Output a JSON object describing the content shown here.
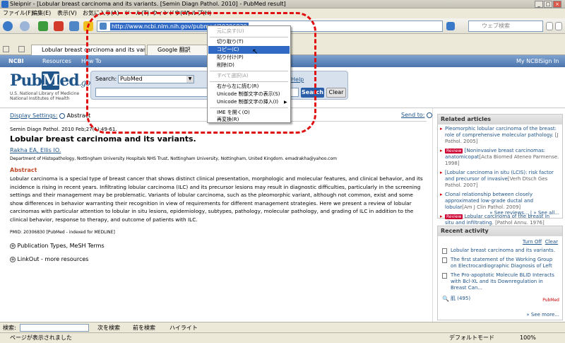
{
  "window": {
    "title": "Sleipnir - [Lobular breast carcinoma and its variants. [Semin Diagn Pathol. 2010] - PubMed result]",
    "min": "_",
    "max": "□",
    "close": "×"
  },
  "menubar": [
    "ファイル(F)",
    "編集(E)",
    "表示(V)",
    "お気に入り(A)",
    "ツール(T)",
    "ウィンドウ(W)",
    "ヘルプ(H)"
  ],
  "address": {
    "url": "http://www.ncbi.nlm.nih.gov/pubmed/20306830"
  },
  "websearch": {
    "placeholder": "ウェブ検索"
  },
  "tabs": [
    {
      "label": "Lobular breast carcinoma and its variants. [..."
    },
    {
      "label": "Google 翻訳"
    }
  ],
  "ncbi": {
    "logo": "NCBI",
    "resources": "Resources",
    "howto": "How To",
    "myncbi": "My NCBI",
    "signin": "Sign In"
  },
  "pubmed": {
    "logo_pub": "Pub",
    "logo_m": "M",
    "logo_ed": "ed",
    "logo_gov": ".gov",
    "nlm1": "U.S. National Library of Medicine",
    "nlm2": "National Institutes of Health",
    "search_label": "Search:",
    "db": "PubMed",
    "search_btn": "Search",
    "clear_btn": "Clear",
    "help": "Help"
  },
  "article": {
    "display_settings": "Display Settings:",
    "format": "Abstract",
    "send_to": "Send to:",
    "citation": "Semin Diagn Pathol. 2010 Feb;27(1):49-61.",
    "title": "Lobular breast carcinoma and its variants.",
    "authors": "Rakha EA, Ellis IO.",
    "affiliation": "Department of Histopathology, Nottingham University Hospitals NHS Trust, Nottingham University, Nottingham, United Kingdom. emadrakha@yahoo.com",
    "abstract_heading": "Abstract",
    "abstract": "Lobular carcinoma is a special type of breast cancer that shows distinct clinical presentation, morphologic and molecular features, and clinical behavior, and its incidence is rising in recent years. Infiltrating lobular carcinoma (ILC) and its precursor lesions may result in diagnostic difficulties, particularly in the screening settings and their management may be problematic. Variants of lobular carcinoma, such as the pleomorphic variant, although not common, exist and some show differences in behavior warranting their recognition in view of requirements for different management strategies. Here we present a review of lobular carcinomas with particular attention to lobular in situ lesions, epidemiology, subtypes, pathology, molecular pathology, and grading of ILC in addition to the clinical behavior, response to therapy, and outcome of patients with ILC.",
    "pmid": "PMID: 20306830 [PubMed - indexed for MEDLINE]",
    "pubtypes": "Publication Types, MeSH Terms",
    "linkout": "LinkOut - more resources"
  },
  "related": {
    "heading": "Related articles",
    "items": [
      {
        "text": "Pleomorphic lobular carcinoma of the breast: role of comprehensive molecular pathology.",
        "review": "",
        "src": "[J Pathol. 2005]"
      },
      {
        "text": "[Noninvasive breast carcinomas: anatomicopat",
        "review": "Review",
        "src": "[Acta Biomed Ateneo Parmense. 1998]"
      },
      {
        "text": "[Lobular carcinoma in situ (LCIS): risk factor and precursor of invasive",
        "review": "",
        "src": "[Verh Dtsch Ges Pathol. 2007]"
      },
      {
        "text": "Clonal relationship between closely approximated low-grade ductal and lobular",
        "review": "",
        "src": "[Am J Clin Pathol. 2009]"
      },
      {
        "text": "Lobular carcinoma of the breast in situ and infiltrating.",
        "review": "Review",
        "src": "[Pathol Annu. 1976]"
      }
    ],
    "see_reviews": "» See reviews...",
    "see_all": "» See all..."
  },
  "recent": {
    "heading": "Recent activity",
    "turn_off": "Turn Off",
    "clear": "Clear",
    "items": [
      "Lobular breast carcinoma and its variants.",
      "The first statement of the Working Group on Electrocardiographic Diagnosis of Left",
      "The Pro-apoptotic Molecule BLID Interacts with Bcl-XL and Its Downregulation in Breast Can..."
    ],
    "search_term": "肌 (495)",
    "pubmed_tag": "PubMed",
    "see_more": "» See more..."
  },
  "findbar": {
    "label": "検索:",
    "next": "次を検索",
    "prev": "前を検索",
    "highlight": "ハイライト"
  },
  "status": {
    "text": "ページが表示されました",
    "mode": "デフォルトモード",
    "zoom": "100%"
  },
  "context_menu": {
    "items": [
      "元に戻す(U)",
      "切り取り(T)",
      "コピー(C)",
      "貼り付け(P)",
      "削除(D)",
      "すべて選択(A)",
      "右から左に読む(R)",
      "Unicode 制御文字の表示(S)",
      "Unicode 制御文字の挿入(I)",
      "IME を開く(O)",
      "再変換(R)"
    ]
  },
  "colors": {
    "ncbi_blue": "#4b75ac",
    "link": "#20558a",
    "selection": "#316ac5",
    "annotation": "#e01010"
  }
}
